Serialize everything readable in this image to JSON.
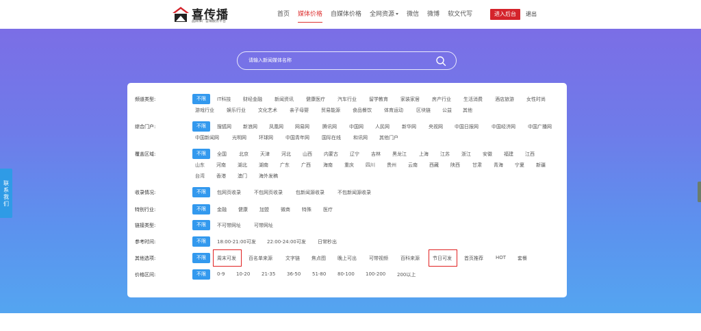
{
  "header": {
    "logo_text": "喜传播",
    "logo_sub": "品牌推广营销服务平台",
    "nav": [
      {
        "label": "首页"
      },
      {
        "label": "媒体价格"
      },
      {
        "label": "自媒体价格"
      },
      {
        "label": "全网资源"
      },
      {
        "label": "微信"
      },
      {
        "label": "微博"
      },
      {
        "label": "软文代写"
      }
    ],
    "backend_label": "进入后台",
    "logout_label": "退出"
  },
  "search": {
    "placeholder": "请输入新闻媒体名称"
  },
  "contact": {
    "label": "联系我们"
  },
  "filters": {
    "all_label": "不限",
    "channel": {
      "label": "频道类型:",
      "options": [
        "IT科技",
        "财经金融",
        "新闻资讯",
        "健康医疗",
        "汽车行业",
        "留学教育",
        "家装家居",
        "房产行业",
        "生活消费",
        "酒店旅游",
        "女性时尚",
        "游戏行业",
        "娱乐行业",
        "文化艺术",
        "亲子母婴",
        "贸易能源",
        "食品餐饮",
        "体育运动",
        "区块链",
        "公益",
        "其他"
      ]
    },
    "portal": {
      "label": "综合门户:",
      "options": [
        "搜狐网",
        "新浪网",
        "凤凰网",
        "网易网",
        "腾讯网",
        "中国网",
        "人民网",
        "新华网",
        "央视网",
        "中国日报网",
        "中国经济网",
        "中国广播网",
        "中国新闻网",
        "光明网",
        "环球网",
        "中国青年网",
        "国际在线",
        "和讯网",
        "其他门户"
      ]
    },
    "region": {
      "label": "覆盖区域:",
      "options": [
        "全国",
        "北京",
        "天津",
        "河北",
        "山西",
        "内蒙古",
        "辽宁",
        "吉林",
        "黑龙江",
        "上海",
        "江苏",
        "浙江",
        "安徽",
        "福建",
        "江西",
        "山东",
        "河南",
        "湖北",
        "湖南",
        "广东",
        "广西",
        "海南",
        "重庆",
        "四川",
        "贵州",
        "云南",
        "西藏",
        "陕西",
        "甘肃",
        "青海",
        "宁夏",
        "新疆",
        "台湾",
        "香港",
        "澳门",
        "海外发稿"
      ]
    },
    "inclusion": {
      "label": "收录情况:",
      "options": [
        "包网页收录",
        "不包网页收录",
        "包新闻源收录",
        "不包新闻源收录"
      ]
    },
    "industry": {
      "label": "特别行业:",
      "options": [
        "金融",
        "健康",
        "加盟",
        "微商",
        "特殊",
        "医疗"
      ]
    },
    "link": {
      "label": "链接类型:",
      "options": [
        "不可带网址",
        "可带网址"
      ]
    },
    "time": {
      "label": "参考时间:",
      "options": [
        "18:00-21:00可发",
        "22:00-24:00可发",
        "日常秒出"
      ]
    },
    "other": {
      "label": "其他选项:",
      "options": [
        "周末可发",
        "百名单来源",
        "文字链",
        "焦点图",
        "晚上可出",
        "可带视频",
        "百科来源",
        "节日可发",
        "首页推荐",
        "HOT",
        "套餐"
      ]
    },
    "price": {
      "label": "价格区间:",
      "options": [
        "0-9",
        "10-20",
        "21-35",
        "36-50",
        "51-80",
        "80-100",
        "100-200",
        "200以上"
      ]
    }
  },
  "colors": {
    "accent_red": "#d4232b",
    "all_button_blue": "#3399ee",
    "highlight_red": "#e02020",
    "gradient_top": "#7b6ee6",
    "gradient_bottom": "#54a5f0"
  }
}
